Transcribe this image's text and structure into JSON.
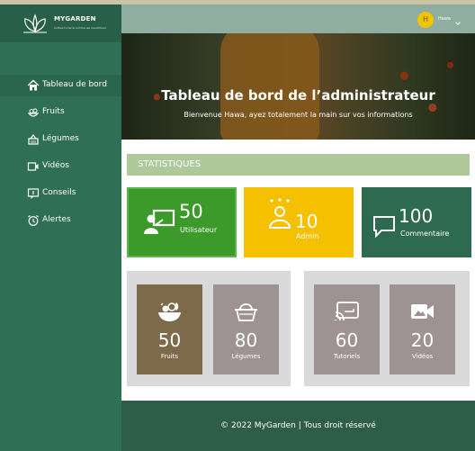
{
  "brand": {
    "name": "MYGARDEN",
    "tagline": "Cultive tu terre comme les maraîchers"
  },
  "sidebar": {
    "items": [
      {
        "label": "Tableau de bord",
        "icon": "home-icon"
      },
      {
        "label": "Fruits",
        "icon": "fruit-icon"
      },
      {
        "label": "Légumes",
        "icon": "basket-icon"
      },
      {
        "label": "Vidéos",
        "icon": "video-icon"
      },
      {
        "label": "Conseils",
        "icon": "advice-icon"
      },
      {
        "label": "Alertes",
        "icon": "alarm-icon"
      }
    ]
  },
  "user": {
    "initial": "H",
    "name": "Hawa"
  },
  "hero": {
    "title": "Tableau de bord de l’administrateur",
    "subtitle": "Bienvenue Hawa, ayez totalement la main sur vos informations"
  },
  "stats": {
    "heading": "STATISTIQUES"
  },
  "cards": {
    "users": {
      "value": "50",
      "label": "Utilisateur"
    },
    "admin": {
      "value": "10",
      "label": "Admin"
    },
    "comments": {
      "value": "100",
      "label": "Commentaire"
    }
  },
  "tiles": {
    "fruits": {
      "value": "50",
      "label": "Fruits"
    },
    "vegetables": {
      "value": "80",
      "label": "Légumes"
    },
    "tutorials": {
      "value": "60",
      "label": "Tutoriels"
    },
    "videos": {
      "value": "20",
      "label": "Vidéos"
    }
  },
  "footer": {
    "text": "© 2022  MyGarden | Tous droit réservé"
  },
  "colors": {
    "sidebar": "#2e6f55",
    "stats_bar": "#aec899",
    "users_card": "#3c9a2a",
    "admin_card": "#f5c000",
    "comments_card": "#2d6a50",
    "fruits_tile": "#7d6a4a",
    "grey_tile": "#9e9292",
    "footer": "#2e5e48"
  }
}
